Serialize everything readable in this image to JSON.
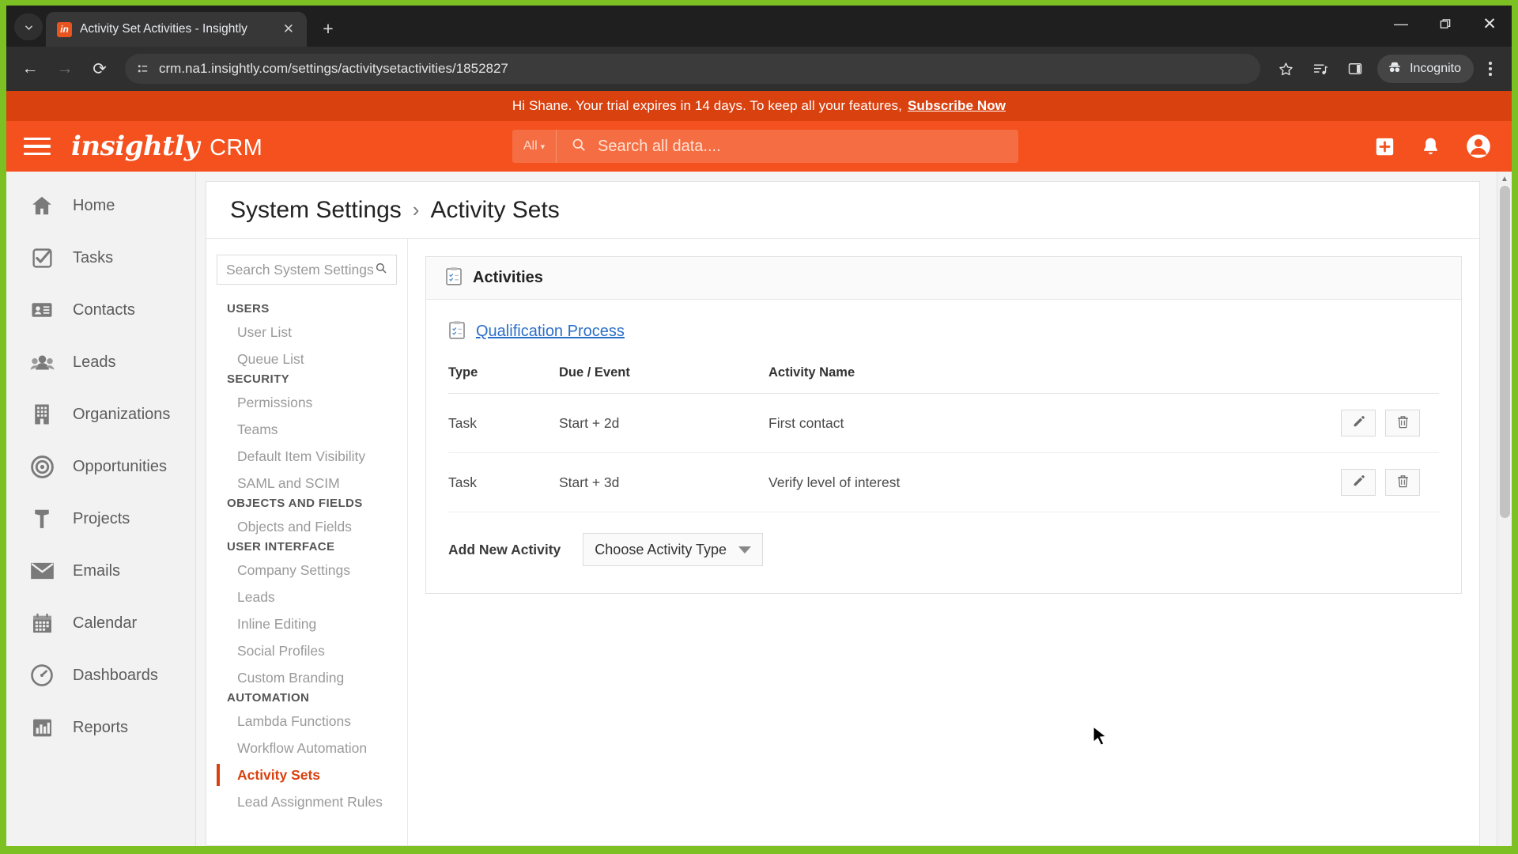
{
  "browser": {
    "tab": {
      "title": "Activity Set Activities - Insightly",
      "favicon_label": "in",
      "close_label": "✕"
    },
    "new_tab_label": "+",
    "tab_search_icon": "chevron-down-icon",
    "window": {
      "minimize": "—",
      "maximize": "❐",
      "close": "✕"
    },
    "toolbar": {
      "back": "←",
      "forward": "→",
      "reload": "⟳",
      "url": "crm.na1.insightly.com/settings/activitysetactivities/1852827",
      "site_info_icon": "page-info-icon",
      "bookmark_icon": "star-icon",
      "reading_list_icon": "reading-list-icon",
      "side_panel_icon": "side-panel-icon",
      "incognito_label": "Incognito",
      "menu_icon": "kebab-menu-icon"
    }
  },
  "banner": {
    "message": "Hi Shane. Your trial expires in 14 days. To keep all your features,",
    "link": "Subscribe Now"
  },
  "app_header": {
    "logo": "insightly",
    "product": "CRM",
    "search_scope": "All",
    "search_placeholder": "Search all data....",
    "add_icon": "plus-square-icon",
    "bell_icon": "bell-icon",
    "account_icon": "user-avatar-icon"
  },
  "mainnav": {
    "items": [
      {
        "label": "Home",
        "icon": "home-icon"
      },
      {
        "label": "Tasks",
        "icon": "task-check-icon"
      },
      {
        "label": "Contacts",
        "icon": "contact-card-icon"
      },
      {
        "label": "Leads",
        "icon": "people-icon"
      },
      {
        "label": "Organizations",
        "icon": "building-icon"
      },
      {
        "label": "Opportunities",
        "icon": "target-icon"
      },
      {
        "label": "Projects",
        "icon": "hammer-icon"
      },
      {
        "label": "Emails",
        "icon": "envelope-icon"
      },
      {
        "label": "Calendar",
        "icon": "calendar-icon"
      },
      {
        "label": "Dashboards",
        "icon": "gauge-icon"
      },
      {
        "label": "Reports",
        "icon": "bar-chart-icon"
      }
    ]
  },
  "breadcrumb": {
    "root": "System Settings",
    "separator": "›",
    "current": "Activity Sets"
  },
  "settings_nav": {
    "search_placeholder": "Search System Settings",
    "search_icon": "search-icon",
    "groups": [
      {
        "title": "USERS",
        "items": [
          {
            "label": "User List",
            "active": false
          },
          {
            "label": "Queue List",
            "active": false
          }
        ]
      },
      {
        "title": "SECURITY",
        "items": [
          {
            "label": "Permissions",
            "active": false
          },
          {
            "label": "Teams",
            "active": false
          },
          {
            "label": "Default Item Visibility",
            "active": false
          },
          {
            "label": "SAML and SCIM",
            "active": false
          }
        ]
      },
      {
        "title": "OBJECTS AND FIELDS",
        "items": [
          {
            "label": "Objects and Fields",
            "active": false
          }
        ]
      },
      {
        "title": "USER INTERFACE",
        "items": [
          {
            "label": "Company Settings",
            "active": false
          },
          {
            "label": "Leads",
            "active": false
          },
          {
            "label": "Inline Editing",
            "active": false
          },
          {
            "label": "Social Profiles",
            "active": false
          },
          {
            "label": "Custom Branding",
            "active": false
          }
        ]
      },
      {
        "title": "AUTOMATION",
        "items": [
          {
            "label": "Lambda Functions",
            "active": false
          },
          {
            "label": "Workflow Automation",
            "active": false
          },
          {
            "label": "Activity Sets",
            "active": true
          },
          {
            "label": "Lead Assignment Rules",
            "active": false
          }
        ]
      }
    ]
  },
  "panel": {
    "title": "Activities",
    "title_icon": "clipboard-icon",
    "process_name": "Qualification Process",
    "process_icon": "clipboard-icon",
    "table": {
      "headers": [
        "Type",
        "Due / Event",
        "Activity Name"
      ],
      "rows": [
        {
          "type": "Task",
          "due": "Start + 2d",
          "name": "First contact",
          "edit_icon": "pencil-icon",
          "delete_icon": "trash-icon"
        },
        {
          "type": "Task",
          "due": "Start + 3d",
          "name": "Verify level of interest",
          "edit_icon": "pencil-icon",
          "delete_icon": "trash-icon"
        }
      ]
    },
    "add_label": "Add New Activity",
    "add_select_value": "Choose Activity Type"
  },
  "colors": {
    "brand_orange": "#f4511e",
    "banner_orange": "#d9410f",
    "active_red": "#d9410f",
    "link_blue": "#2a6fc9",
    "frame_green": "#7cc023"
  }
}
